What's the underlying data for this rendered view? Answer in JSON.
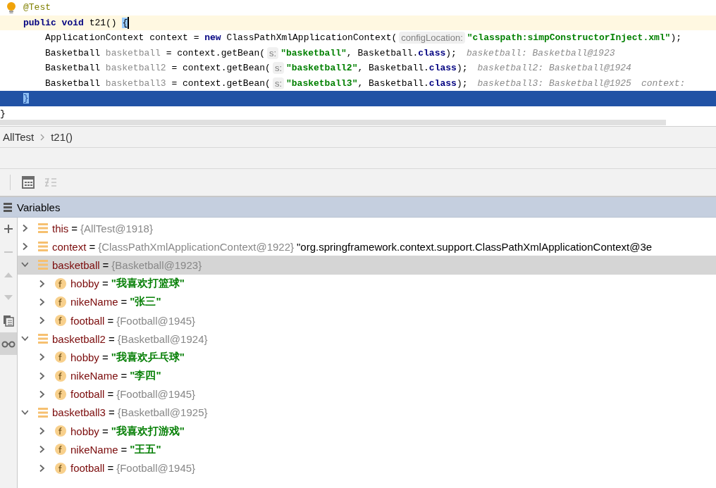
{
  "editor": {
    "method": {
      "annotation": [
        {
          "kind": "annotation",
          "text": "@Test"
        }
      ],
      "signature": [
        {
          "kind": "keyword",
          "text": "public void"
        },
        {
          "kind": "plain",
          "text": " t21() "
        },
        {
          "kind": "brace",
          "text": "{"
        }
      ],
      "body": [
        {
          "tokens": [
            {
              "kind": "plain",
              "text": "ApplicationContext context = "
            },
            {
              "kind": "keyword",
              "text": "new"
            },
            {
              "kind": "plain",
              "text": " ClassPathXmlApplicationContext("
            },
            {
              "kind": "param",
              "text": "configLocation:"
            },
            {
              "kind": "string",
              "text": "\"classpath:simpConstructorInject.xml\""
            },
            {
              "kind": "plain",
              "text": ");"
            }
          ]
        },
        {
          "tokens": [
            {
              "kind": "plain",
              "text": "Basketball "
            },
            {
              "kind": "unused",
              "text": "basketball"
            },
            {
              "kind": "plain",
              "text": " = context.getBean("
            },
            {
              "kind": "param",
              "text": "s:"
            },
            {
              "kind": "string",
              "text": "\"basketball\""
            },
            {
              "kind": "plain",
              "text": ", Basketball."
            },
            {
              "kind": "keyword",
              "text": "class"
            },
            {
              "kind": "plain",
              "text": ");"
            },
            {
              "kind": "hint",
              "text": "basketball: Basketball@1923"
            }
          ]
        },
        {
          "tokens": [
            {
              "kind": "plain",
              "text": "Basketball "
            },
            {
              "kind": "unused",
              "text": "basketball2"
            },
            {
              "kind": "plain",
              "text": " = context.getBean("
            },
            {
              "kind": "param",
              "text": "s:"
            },
            {
              "kind": "string",
              "text": "\"basketball2\""
            },
            {
              "kind": "plain",
              "text": ", Basketball."
            },
            {
              "kind": "keyword",
              "text": "class"
            },
            {
              "kind": "plain",
              "text": ");"
            },
            {
              "kind": "hint",
              "text": "basketball2: Basketball@1924"
            }
          ]
        },
        {
          "tokens": [
            {
              "kind": "plain",
              "text": "Basketball "
            },
            {
              "kind": "unused",
              "text": "basketball3"
            },
            {
              "kind": "plain",
              "text": " = context.getBean("
            },
            {
              "kind": "param",
              "text": "s:"
            },
            {
              "kind": "string",
              "text": "\"basketball3\""
            },
            {
              "kind": "plain",
              "text": ", Basketball."
            },
            {
              "kind": "keyword",
              "text": "class"
            },
            {
              "kind": "plain",
              "text": ");"
            },
            {
              "kind": "hint",
              "text": "basketball3: Basketball@1925"
            },
            {
              "kind": "hint",
              "text": "context:"
            }
          ]
        }
      ],
      "closing": [
        {
          "kind": "brace",
          "text": "}"
        }
      ]
    },
    "after": [
      {
        "kind": "plain",
        "text": "}"
      }
    ]
  },
  "breadcrumb": [
    "AllTest",
    "t21()"
  ],
  "toolbar": [
    {
      "kind": "calculator",
      "disabled": false
    },
    {
      "kind": "layout",
      "disabled": true
    }
  ],
  "side_toolbar": [
    {
      "kind": "add",
      "disabled": false,
      "selected": false
    },
    {
      "kind": "remove",
      "disabled": true,
      "selected": false
    },
    {
      "kind": "up",
      "disabled": true,
      "selected": false
    },
    {
      "kind": "down",
      "disabled": true,
      "selected": false
    },
    {
      "kind": "copy",
      "disabled": false,
      "selected": false
    },
    {
      "kind": "watches",
      "disabled": false,
      "selected": true
    }
  ],
  "variables": {
    "title": "Variables",
    "items": [
      {
        "kind": "object",
        "name": "this",
        "op": "=",
        "value": "{AllTest@1918}",
        "is_string": false,
        "expanded": false,
        "selected": false
      },
      {
        "kind": "object",
        "name": "context",
        "op": "=",
        "value": "{ClassPathXmlApplicationContext@1922}",
        "is_string": false,
        "detail": "\"org.springframework.context.support.ClassPathXmlApplicationContext@3e",
        "expanded": false,
        "selected": false
      },
      {
        "kind": "object",
        "name": "basketball",
        "op": "=",
        "value": "{Basketball@1923}",
        "is_string": false,
        "expanded": true,
        "selected": true,
        "children": [
          {
            "kind": "field",
            "name": "hobby",
            "op": "=",
            "value": "\"我喜欢打篮球\"",
            "is_string": true,
            "expanded": false,
            "selected": false
          },
          {
            "kind": "field",
            "name": "nikeName",
            "op": "=",
            "value": "\"张三\"",
            "is_string": true,
            "expanded": false,
            "selected": false
          },
          {
            "kind": "field",
            "name": "football",
            "op": "=",
            "value": "{Football@1945}",
            "is_string": false,
            "expanded": false,
            "selected": false
          }
        ]
      },
      {
        "kind": "object",
        "name": "basketball2",
        "op": "=",
        "value": "{Basketball@1924}",
        "is_string": false,
        "expanded": true,
        "selected": false,
        "children": [
          {
            "kind": "field",
            "name": "hobby",
            "op": "=",
            "value": "\"我喜欢乒乓球\"",
            "is_string": true,
            "expanded": false,
            "selected": false
          },
          {
            "kind": "field",
            "name": "nikeName",
            "op": "=",
            "value": "\"李四\"",
            "is_string": true,
            "expanded": false,
            "selected": false
          },
          {
            "kind": "field",
            "name": "football",
            "op": "=",
            "value": "{Football@1945}",
            "is_string": false,
            "expanded": false,
            "selected": false
          }
        ]
      },
      {
        "kind": "object",
        "name": "basketball3",
        "op": "=",
        "value": "{Basketball@1925}",
        "is_string": false,
        "expanded": true,
        "selected": false,
        "children": [
          {
            "kind": "field",
            "name": "hobby",
            "op": "=",
            "value": "\"我喜欢打游戏\"",
            "is_string": true,
            "expanded": false,
            "selected": false
          },
          {
            "kind": "field",
            "name": "nikeName",
            "op": "=",
            "value": "\"王五\"",
            "is_string": true,
            "expanded": false,
            "selected": false
          },
          {
            "kind": "field",
            "name": "football",
            "op": "=",
            "value": "{Football@1945}",
            "is_string": false,
            "expanded": false,
            "selected": false
          }
        ]
      }
    ]
  }
}
